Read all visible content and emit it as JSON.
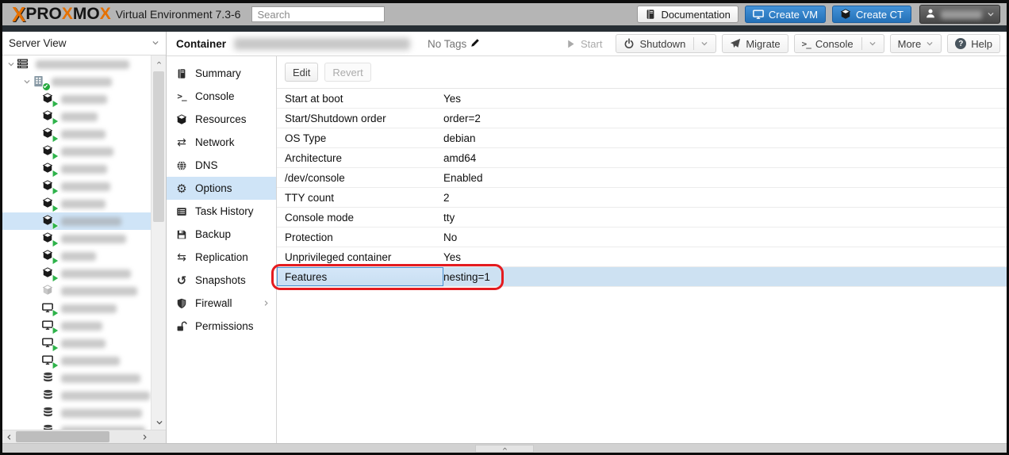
{
  "header": {
    "logo_text": "PROXMOX",
    "version_text": "Virtual Environment 7.3-6",
    "search_placeholder": "Search",
    "actions": [
      {
        "id": "documentation",
        "label": "Documentation",
        "icon": "book",
        "style": "light"
      },
      {
        "id": "create-vm",
        "label": "Create VM",
        "icon": "monitor",
        "style": "primary"
      },
      {
        "id": "create-ct",
        "label": "Create CT",
        "icon": "cube",
        "style": "primary"
      }
    ],
    "user_menu": {
      "redacted": true
    }
  },
  "ct_toolbar": {
    "type_label": "Container",
    "name_redacted": true,
    "tags_label": "No Tags",
    "actions": [
      {
        "id": "start",
        "label": "Start",
        "icon": "play",
        "disabled": true
      },
      {
        "id": "shutdown",
        "label": "Shutdown",
        "icon": "power",
        "split": true
      },
      {
        "id": "migrate",
        "label": "Migrate",
        "icon": "send"
      },
      {
        "id": "console",
        "label": "Console",
        "icon": "terminal",
        "split": true
      },
      {
        "id": "more",
        "label": "More",
        "caret": true
      },
      {
        "id": "help",
        "label": "Help",
        "icon": "help"
      }
    ]
  },
  "sidebar": {
    "view_label": "Server View",
    "tree_rows": [
      {
        "type": "datacenter",
        "level": 0,
        "expanded": true,
        "redacted_width": 118
      },
      {
        "type": "node",
        "level": 1,
        "expanded": true,
        "redacted_width": 76
      },
      {
        "type": "ct-running",
        "level": 2,
        "redacted_width": 58
      },
      {
        "type": "ct-running",
        "level": 2,
        "redacted_width": 46
      },
      {
        "type": "ct-running",
        "level": 2,
        "redacted_width": 56
      },
      {
        "type": "ct-running",
        "level": 2,
        "redacted_width": 66
      },
      {
        "type": "ct-running",
        "level": 2,
        "redacted_width": 58
      },
      {
        "type": "ct-running",
        "level": 2,
        "redacted_width": 62
      },
      {
        "type": "ct-running",
        "level": 2,
        "redacted_width": 56
      },
      {
        "type": "ct-running",
        "level": 2,
        "redacted_width": 76,
        "selected": true
      },
      {
        "type": "ct-running",
        "level": 2,
        "redacted_width": 82
      },
      {
        "type": "ct-running",
        "level": 2,
        "redacted_width": 44
      },
      {
        "type": "ct-running",
        "level": 2,
        "redacted_width": 88
      },
      {
        "type": "ct-stopped",
        "level": 2,
        "redacted_width": 96
      },
      {
        "type": "vm-running",
        "level": 2,
        "redacted_width": 70
      },
      {
        "type": "vm-running",
        "level": 2,
        "redacted_width": 52
      },
      {
        "type": "vm-running",
        "level": 2,
        "redacted_width": 56
      },
      {
        "type": "vm-running",
        "level": 2,
        "redacted_width": 74
      },
      {
        "type": "storage",
        "level": 2,
        "redacted_width": 100
      },
      {
        "type": "storage",
        "level": 2,
        "redacted_width": 112
      },
      {
        "type": "storage",
        "level": 2,
        "redacted_width": 102
      },
      {
        "type": "storage",
        "level": 2,
        "redacted_width": 106
      }
    ]
  },
  "menu": {
    "items": [
      {
        "label": "Summary",
        "icon": "book"
      },
      {
        "label": "Console",
        "icon": "terminal"
      },
      {
        "label": "Resources",
        "icon": "cube"
      },
      {
        "label": "Network",
        "icon": "arrows"
      },
      {
        "label": "DNS",
        "icon": "globe"
      },
      {
        "label": "Options",
        "icon": "gear",
        "selected": true
      },
      {
        "label": "Task History",
        "icon": "list"
      },
      {
        "label": "Backup",
        "icon": "floppy"
      },
      {
        "label": "Replication",
        "icon": "retweet"
      },
      {
        "label": "Snapshots",
        "icon": "history"
      },
      {
        "label": "Firewall",
        "icon": "shield",
        "expandable": true
      },
      {
        "label": "Permissions",
        "icon": "unlock"
      }
    ]
  },
  "options_panel": {
    "toolbar": [
      {
        "id": "edit",
        "label": "Edit"
      },
      {
        "id": "revert",
        "label": "Revert",
        "disabled": true
      }
    ],
    "rows": [
      {
        "label": "Start at boot",
        "value": "Yes"
      },
      {
        "label": "Start/Shutdown order",
        "value": "order=2"
      },
      {
        "label": "OS Type",
        "value": "debian"
      },
      {
        "label": "Architecture",
        "value": "amd64"
      },
      {
        "label": "/dev/console",
        "value": "Enabled"
      },
      {
        "label": "TTY count",
        "value": "2"
      },
      {
        "label": "Console mode",
        "value": "tty"
      },
      {
        "label": "Protection",
        "value": "No"
      },
      {
        "label": "Unprivileged container",
        "value": "Yes"
      },
      {
        "label": "Features",
        "value": "nesting=1",
        "selected": true,
        "annotated": true
      }
    ]
  },
  "colors": {
    "header_gray": "#b5b5b5",
    "accent_blue": "#2f7fc6",
    "selection_blue": "#cfe4f7",
    "annotation_red": "#e41b1f",
    "running_green": "#2eb34a",
    "logo_orange": "#e57000"
  }
}
